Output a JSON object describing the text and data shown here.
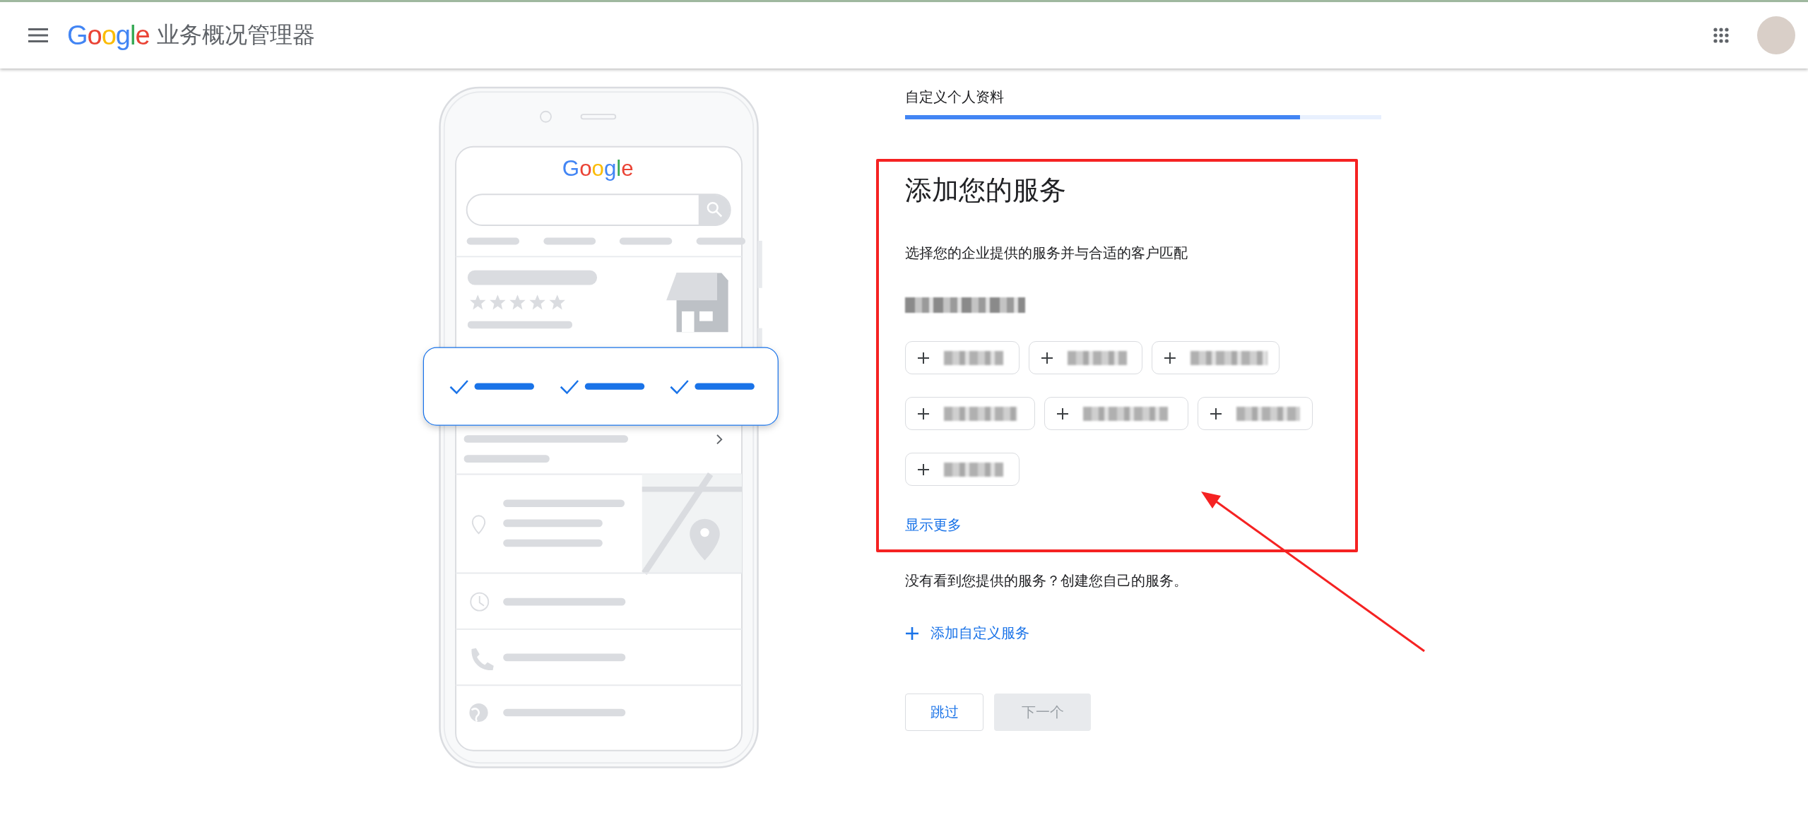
{
  "header": {
    "logo": "Google",
    "title": "业务概况管理器"
  },
  "illustration": {
    "logo": "Google"
  },
  "step": {
    "label": "自定义个人资料",
    "level": 0.83
  },
  "section": {
    "title": "添加您的服务",
    "subtitle": "选择您的企业提供的服务并与合适的客户匹配",
    "show_more": "显示更多"
  },
  "service_rows": [
    [
      {
        "selected": false
      },
      {
        "selected": false
      },
      {
        "selected": false
      }
    ],
    [
      {
        "selected": false
      },
      {
        "selected": false
      },
      {
        "selected": false
      }
    ],
    [
      {
        "selected": false
      }
    ]
  ],
  "custom": {
    "prompt": "没有看到您提供的服务？创建您自己的服务。",
    "add_label": "添加自定义服务"
  },
  "buttons": [
    {
      "label": "跳过",
      "disabled": false
    },
    {
      "label": "下一个",
      "disabled": true
    }
  ],
  "annotation": {
    "box": true,
    "arrow": true
  }
}
